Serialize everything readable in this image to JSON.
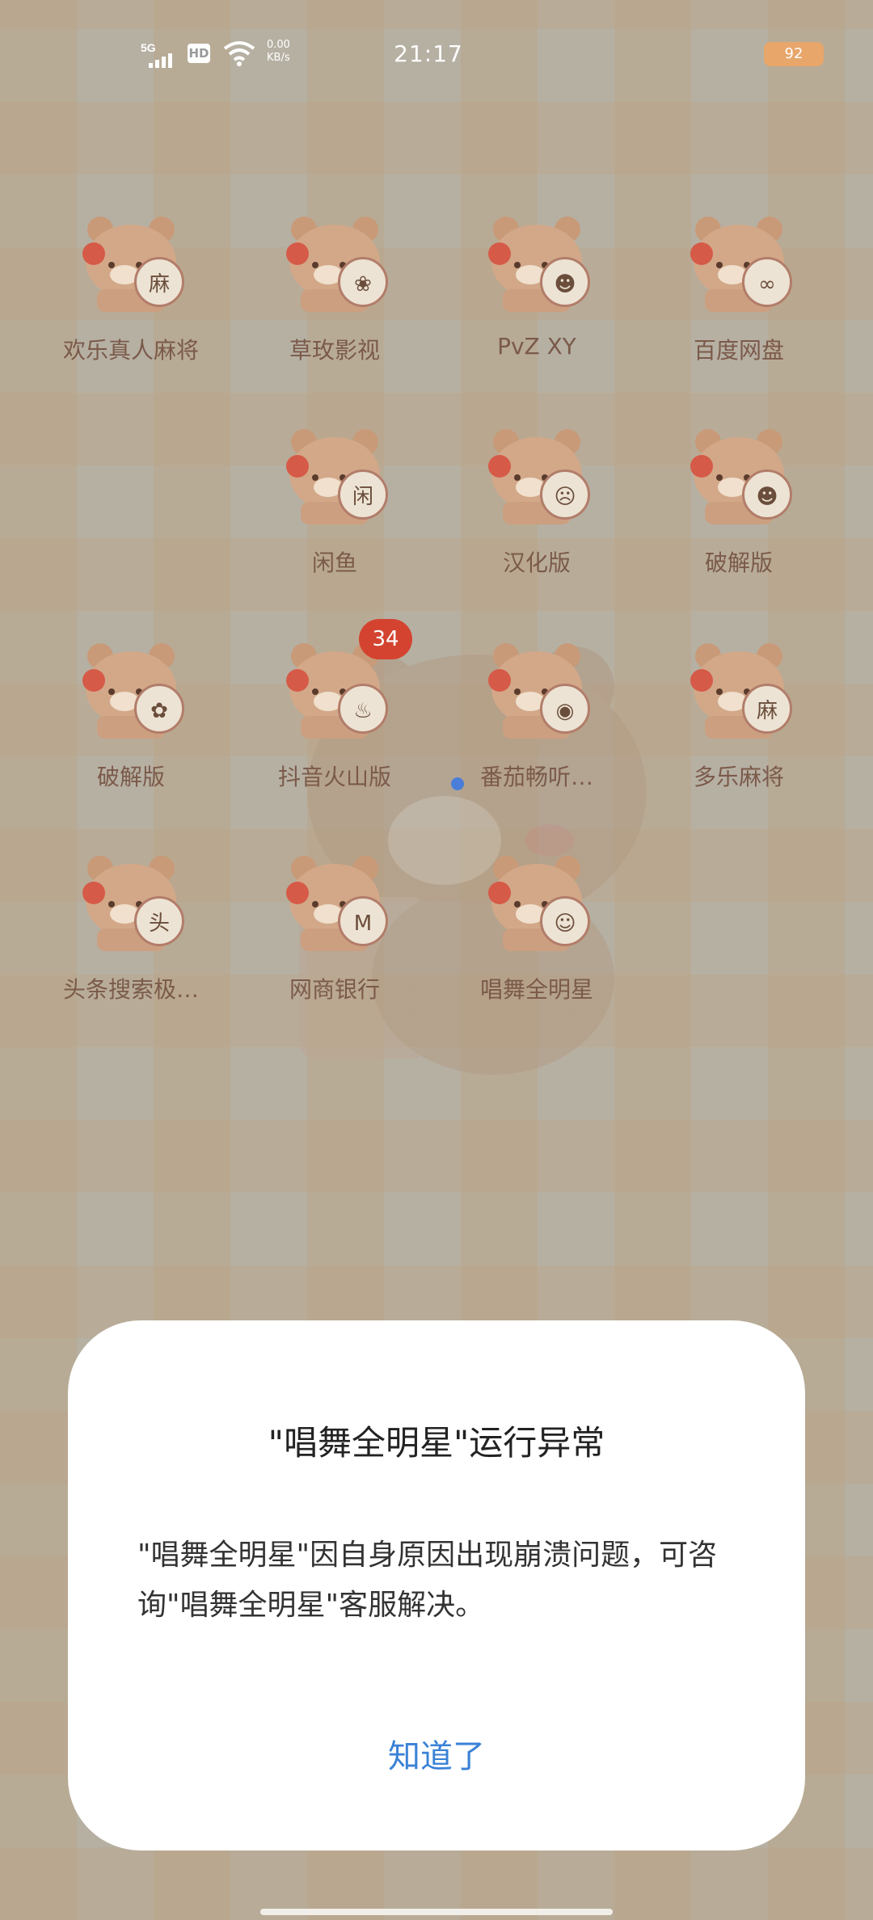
{
  "status_bar": {
    "network": "5G",
    "hd": "HD",
    "speed_value": "0.00",
    "speed_unit": "KB/s",
    "time": "21:17",
    "battery": "92"
  },
  "apps": [
    {
      "label": "欢乐真人麻将",
      "icon": "mahjong-icon",
      "glyph": "麻"
    },
    {
      "label": "草玫影视",
      "icon": "strawberry-video-icon",
      "glyph": "❀"
    },
    {
      "label": "PvZ XY",
      "icon": "zombie-icon",
      "glyph": "☻"
    },
    {
      "label": "百度网盘",
      "icon": "baidu-netdisk-icon",
      "glyph": "∞"
    },
    {
      "label": "闲鱼",
      "icon": "xianyu-icon",
      "glyph": "闲"
    },
    {
      "label": "汉化版",
      "icon": "gourd-game-icon",
      "glyph": "☹"
    },
    {
      "label": "破解版",
      "icon": "zombie-cracked-icon",
      "glyph": "☻"
    },
    {
      "label": "破解版",
      "icon": "gear-cracked-icon",
      "glyph": "✿"
    },
    {
      "label": "抖音火山版",
      "icon": "douyin-huoshan-icon",
      "glyph": "♨"
    },
    {
      "label": "番茄畅听…",
      "icon": "tomato-listen-icon",
      "glyph": "◉"
    },
    {
      "label": "多乐麻将",
      "icon": "duole-mahjong-icon",
      "glyph": "麻"
    },
    {
      "label": "头条搜索极…",
      "icon": "toutiao-search-icon",
      "glyph": "头"
    },
    {
      "label": "网商银行",
      "icon": "mybank-icon",
      "glyph": "M"
    },
    {
      "label": "唱舞全明星",
      "icon": "dance-star-icon",
      "glyph": "☺"
    }
  ],
  "notification_count": "34",
  "dialog": {
    "title": "\"唱舞全明星\"运行异常",
    "message": "\"唱舞全明星\"因自身原因出现崩溃问题，可咨询\"唱舞全明星\"客服解决。",
    "ok_label": "知道了"
  },
  "colors": {
    "accent_button": "#3b82d6",
    "notification": "#d3432f",
    "label_brown": "#7b5a4a"
  }
}
